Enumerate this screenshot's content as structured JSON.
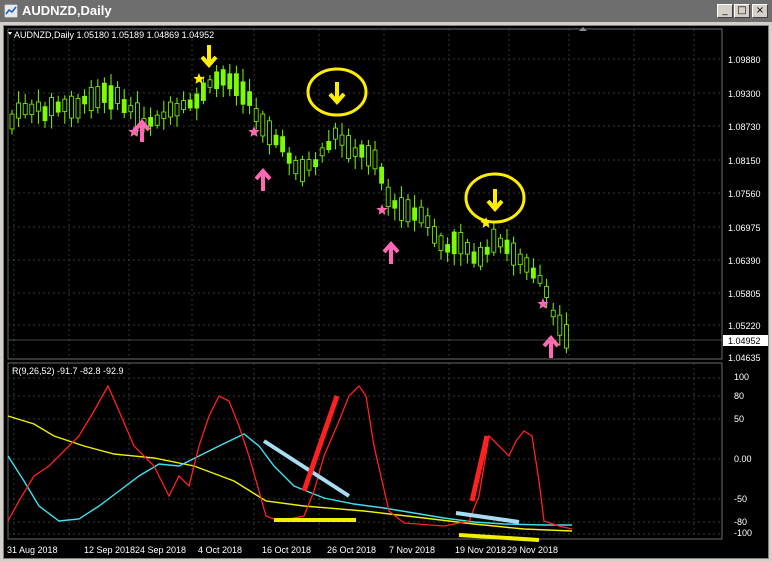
{
  "window": {
    "title": "AUDNZD,Daily",
    "buttons": [
      "minimize",
      "maximize",
      "close"
    ]
  },
  "main_chart": {
    "header": "AUDNZD,Daily  1.05180 1.05189 1.04869 1.04952",
    "price_axis": [
      "1.09880",
      "1.09300",
      "1.08730",
      "1.08150",
      "1.07560",
      "1.06975",
      "1.06390",
      "1.05805",
      "1.05220",
      "1.04635"
    ],
    "current_price": "1.04952"
  },
  "sub_chart": {
    "header": "R(9,26,52) -91.7 -82.8 -92.9",
    "axis": [
      "100",
      "80",
      "50",
      "0.00",
      "-50",
      "-80",
      "-100"
    ]
  },
  "date_axis": [
    "31 Aug 2018",
    "12 Sep 2018",
    "24 Sep 2018",
    "4 Oct 2018",
    "16 Oct 2018",
    "26 Oct 2018",
    "7 Nov 2018",
    "19 Nov 2018",
    "29 Nov 2018"
  ],
  "colors": {
    "background": "#000000",
    "grid": "#4a4a4a",
    "candle": "#7cfc00",
    "up_arrow": "#ff69b4",
    "down_arrow": "#ffee00",
    "annotation_circle": "#ffee00",
    "line_red": "#ff2020",
    "line_cyan": "#40e0f0",
    "line_yellow": "#f0f000"
  },
  "icons": [
    "chart-app-icon",
    "minimize-icon",
    "maximize-icon",
    "close-icon",
    "up-arrow-icon",
    "down-arrow-icon",
    "star-icon"
  ]
}
